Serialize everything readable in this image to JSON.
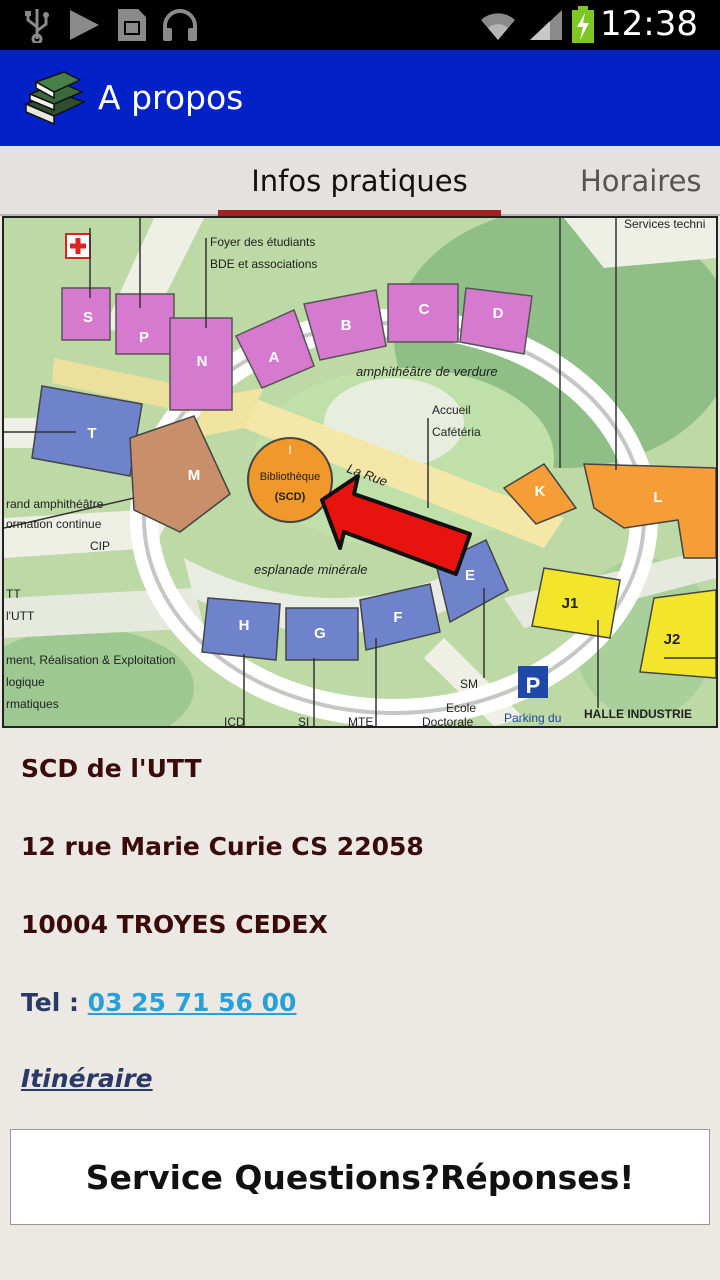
{
  "status_bar": {
    "time": "12:38",
    "icons": [
      "usb-icon",
      "play-icon",
      "sd-card-icon",
      "headphones-icon",
      "wifi-icon",
      "signal-icon",
      "battery-charging-icon"
    ]
  },
  "action_bar": {
    "title": "A propos",
    "icon": "books-icon"
  },
  "tabs": [
    {
      "label": "Infos pratiques",
      "active": true
    },
    {
      "label": "Horaires",
      "active": false
    }
  ],
  "map": {
    "labels": {
      "foyer1": "Foyer des étudiants",
      "foyer2": "BDE et associations",
      "services": "Services techni",
      "amphi_verdure": "amphithéâtre de verdure",
      "accueil": "Accueil",
      "cafeteria": "Cafétéria",
      "biblio1": "Bibliothèque",
      "biblio2": "(SCD)",
      "biblio_i": "I",
      "la_rue": "La Rue",
      "grand_amphi1": "rand amphithéâtre",
      "grand_amphi2": "ormation continue",
      "cip": "CIP",
      "esplanade": "esplanade minérale",
      "tt": "TT",
      "lutt": "l'UTT",
      "realisation": "ment, Réalisation & Exploitation",
      "logique": "logique",
      "rmatiques": "rmatiques",
      "sm": "SM",
      "ecole": "Ecole",
      "doctorale": "Doctorale",
      "parking": "Parking du",
      "parking_p": "P",
      "halle": "HALLE INDUSTRIE",
      "icd": "ICD",
      "si": "SI",
      "mte": "MTE",
      "bS": "S",
      "bP": "P",
      "bN": "N",
      "bA": "A",
      "bB": "B",
      "bC": "C",
      "bD": "D",
      "bT": "T",
      "bM": "M",
      "bK": "K",
      "bL": "L",
      "bE": "E",
      "bF": "F",
      "bG": "G",
      "bH": "H",
      "bJ1": "J1",
      "bJ2": "J2"
    }
  },
  "info": {
    "name": "SCD de l'UTT",
    "address": "12 rue Marie Curie CS 22058",
    "city": "10004 TROYES CEDEX",
    "tel_label": "Tel : ",
    "tel_number": "03 25 71 56 00",
    "itinerary": "Itinéraire"
  },
  "service_button": "Service Questions?Réponses!"
}
